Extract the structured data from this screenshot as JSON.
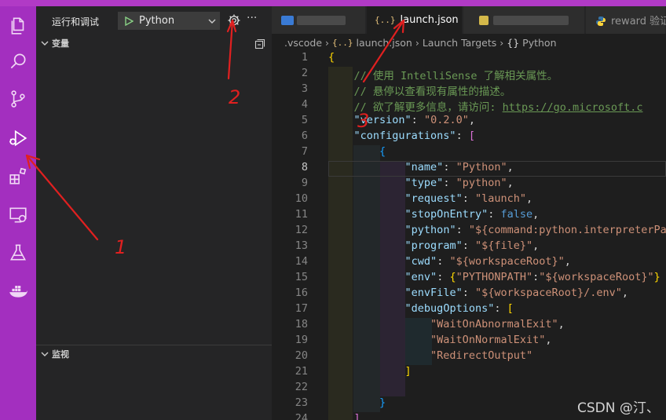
{
  "activity_bar": {
    "icons": [
      "files-icon",
      "search-icon",
      "source-control-icon",
      "run-debug-icon",
      "extensions-icon",
      "remote-explorer-icon",
      "testing-icon",
      "docker-icon"
    ]
  },
  "sidebar": {
    "title": "运行和调试",
    "run_config": "Python",
    "sections": {
      "variables": "变量",
      "watch": "监视"
    }
  },
  "tabs": [
    {
      "label": "",
      "blurred": true
    },
    {
      "label": "launch.json",
      "icon": "{..}",
      "active": true
    },
    {
      "label": "",
      "blurred": true
    },
    {
      "label": "reward 验证",
      "icon": "python-icon"
    }
  ],
  "breadcrumb": [
    ".vscode",
    "›",
    "{..}",
    "launch.json",
    "›",
    "Launch Targets",
    "›",
    "{}",
    "Python"
  ],
  "code_lines": [
    {
      "n": "1",
      "html": "<span class='b'>{</span>"
    },
    {
      "n": "2",
      "html": "    <span class='c'>// 使用 IntelliSense 了解相关属性。</span>"
    },
    {
      "n": "3",
      "html": "    <span class='c'>// 悬停以查看现有属性的描述。</span>"
    },
    {
      "n": "4",
      "html": "    <span class='c'>// 欲了解更多信息，请访问: </span><span class='u'>https://go.microsoft.c</span>"
    },
    {
      "n": "5",
      "html": "    <span class='k'>\"version\"</span>: <span class='s'>\"0.2.0\"</span>,"
    },
    {
      "n": "6",
      "html": "    <span class='k'>\"configurations\"</span>: <span class='b2'>[</span>"
    },
    {
      "n": "7",
      "html": "        <span class='b3'>{</span>"
    },
    {
      "n": "8",
      "html": "            <span class='k'>\"name\"</span>: <span class='s'>\"Python\"</span>,"
    },
    {
      "n": "9",
      "html": "            <span class='k'>\"type\"</span>: <span class='s'>\"python\"</span>,"
    },
    {
      "n": "10",
      "html": "            <span class='k'>\"request\"</span>: <span class='s'>\"launch\"</span>,"
    },
    {
      "n": "11",
      "html": "            <span class='k'>\"stopOnEntry\"</span>: <span class='kw'>false</span>,"
    },
    {
      "n": "12",
      "html": "            <span class='k'>\"python\"</span>: <span class='s'>\"${command:python.interpreterPa</span>"
    },
    {
      "n": "13",
      "html": "            <span class='k'>\"program\"</span>: <span class='s'>\"${file}\"</span>,"
    },
    {
      "n": "14",
      "html": "            <span class='k'>\"cwd\"</span>: <span class='s'>\"${workspaceRoot}\"</span>,"
    },
    {
      "n": "15",
      "html": "            <span class='k'>\"env\"</span>: <span class='b'>{</span><span class='s'>\"PYTHONPATH\"</span>:<span class='s'>\"${workspaceRoot}\"</span><span class='b'>}</span>"
    },
    {
      "n": "16",
      "html": "            <span class='k'>\"envFile\"</span>: <span class='s'>\"${workspaceRoot}/.env\"</span>,"
    },
    {
      "n": "17",
      "html": "            <span class='k'>\"debugOptions\"</span>: <span class='b'>[</span>"
    },
    {
      "n": "18",
      "html": "                <span class='s'>\"WaitOnAbnormalExit\"</span>,"
    },
    {
      "n": "19",
      "html": "                <span class='s'>\"WaitOnNormalExit\"</span>,"
    },
    {
      "n": "20",
      "html": "                <span class='s'>\"RedirectOutput\"</span>"
    },
    {
      "n": "21",
      "html": "            <span class='b'>]</span>"
    },
    {
      "n": "22",
      "html": ""
    },
    {
      "n": "23",
      "html": "        <span class='b3'>}</span>"
    },
    {
      "n": "24",
      "html": "    <span class='b2'>]</span>"
    }
  ],
  "annotations": [
    "1",
    "2",
    "3"
  ],
  "watermark": "CSDN @汀、",
  "colors": {
    "activity_bar": "#a32fbf",
    "annotation_red": "#e02020"
  }
}
